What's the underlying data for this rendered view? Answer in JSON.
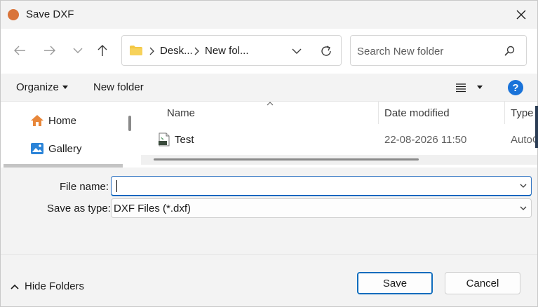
{
  "window": {
    "title": "Save DXF",
    "colors": {
      "app_icon": "#d9743a",
      "accent": "#0f6cbd",
      "help": "#1a73d9"
    }
  },
  "navigation": {
    "back_icon": "arrow-left-icon",
    "forward_icon": "arrow-right-icon",
    "recent_icon": "chevron-down-icon",
    "up_icon": "arrow-up-icon",
    "breadcrumb": [
      "Desk...",
      "New fol..."
    ],
    "search_placeholder": "Search New folder"
  },
  "commandbar": {
    "organize_label": "Organize",
    "new_folder_label": "New folder",
    "view_icon": "list-view-icon",
    "help_label": "?"
  },
  "sidebar": {
    "items": [
      {
        "label": "Home",
        "icon": "home-icon"
      },
      {
        "label": "Gallery",
        "icon": "gallery-icon"
      }
    ]
  },
  "filelist": {
    "columns": [
      "Name",
      "Date modified",
      "Type"
    ],
    "rows": [
      {
        "name": "Test",
        "date_modified": "22-08-2026 11:50",
        "type": "AutoCAD",
        "icon": "dxf-file-icon"
      }
    ]
  },
  "form": {
    "file_name_label": "File name:",
    "file_name_value": "",
    "save_as_type_label": "Save as type:",
    "save_as_type_value": "DXF Files (*.dxf)"
  },
  "footer": {
    "hide_folders_label": "Hide Folders",
    "save_label": "Save",
    "cancel_label": "Cancel"
  }
}
